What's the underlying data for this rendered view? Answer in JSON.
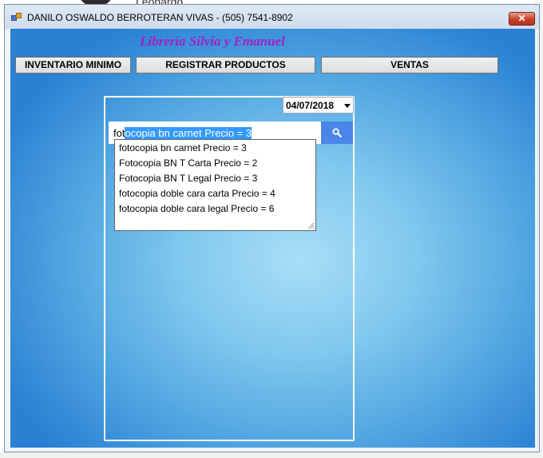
{
  "window": {
    "title": "DANILO OSWALDO BERROTERAN VIVAS - (505) 7541-8902",
    "close_label": "✕"
  },
  "background": {
    "name_fragment": "Leonardo"
  },
  "app": {
    "heading": "Librería Silvia y Emanuel",
    "menu": [
      {
        "label": "INVENTARIO MINIMO"
      },
      {
        "label": "REGISTRAR PRODUCTOS"
      },
      {
        "label": "VENTAS"
      }
    ]
  },
  "date_picker": {
    "value": "04/07/2018"
  },
  "search": {
    "typed_text": "fot",
    "autocomplete_selected": "ocopia bn carnet Precio = 3",
    "suggestions": [
      {
        "label": "fotocopia bn carnet Precio = 3"
      },
      {
        "label": "Fotocopia BN T Carta Precio = 2"
      },
      {
        "label": "Fotocopia BN T Legal Precio = 3"
      },
      {
        "label": "fotocopia doble cara carta Precio = 4"
      },
      {
        "label": "fotocopia doble cara legal Precio = 6"
      }
    ]
  },
  "colors": {
    "heading": "#a020c8",
    "search_button": "#4a86e8",
    "selection": "#3399ff",
    "close_button": "#c7432b"
  },
  "icons": {
    "search_button": "magnifier-icon",
    "window": "app-window-icon"
  }
}
